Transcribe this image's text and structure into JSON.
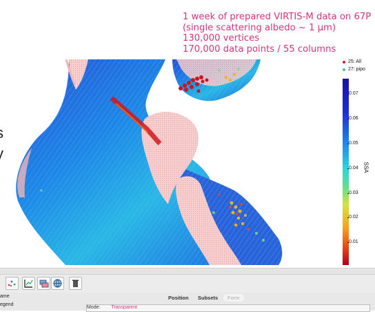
{
  "annotation": {
    "lines": [
      "1 week of prepared VIRTIS-M data on 67P",
      "(single scattering albedo ~ 1 µm)",
      "130,000 vertices",
      "170,000 data points / 55 columns"
    ],
    "color": "#d6337f"
  },
  "legend": {
    "items": [
      {
        "label": "25: All",
        "color": "#d0202a"
      },
      {
        "label": "27: pipo",
        "color": "#39c9a5"
      }
    ]
  },
  "colorbar": {
    "label": "SSA",
    "ticks": [
      "0.07",
      "0.06",
      "0.05",
      "0.04",
      "0.03",
      "0.02",
      "0.01"
    ]
  },
  "left_text": {
    "chars": [
      "s",
      "y"
    ]
  },
  "toolbar": {
    "icons": [
      "scatter-icon",
      "axes-icon",
      "layers-icon",
      "globe-icon",
      "trash-icon"
    ]
  },
  "panel": {
    "sidebar_items": [
      "ame",
      "egend"
    ],
    "tabs": [
      "Position",
      "Subsets",
      "Form"
    ],
    "mode_label": "Mode:",
    "mode_value": "Transparent"
  }
}
